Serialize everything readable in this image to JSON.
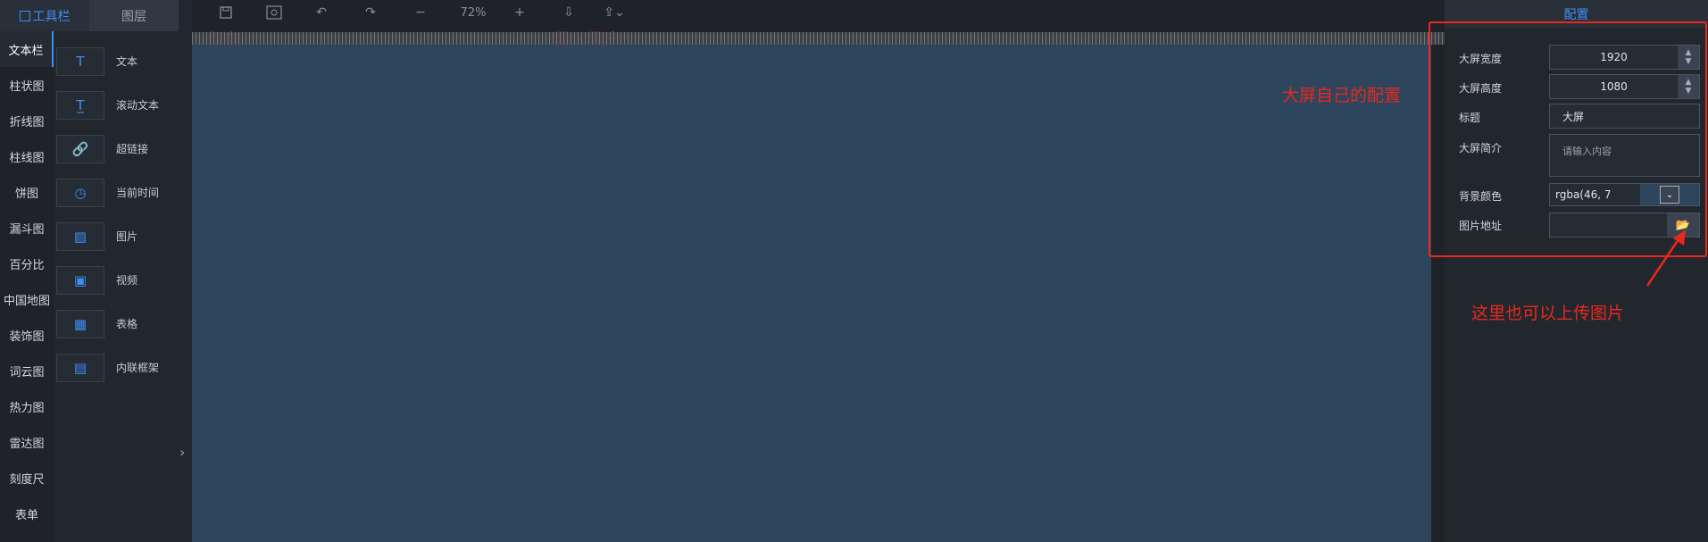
{
  "left_tabs": {
    "toolbox": "工具栏",
    "layers": "图层"
  },
  "categories": [
    "文本栏",
    "柱状图",
    "折线图",
    "柱线图",
    "饼图",
    "漏斗图",
    "百分比",
    "中国地图",
    "装饰图",
    "词云图",
    "热力图",
    "雷达图",
    "刻度尺",
    "表单"
  ],
  "items": [
    {
      "label": "文本",
      "icon": "T"
    },
    {
      "label": "滚动文本",
      "icon": "T̲"
    },
    {
      "label": "超链接",
      "icon": "🔗"
    },
    {
      "label": "当前时间",
      "icon": "◷"
    },
    {
      "label": "图片",
      "icon": "▨"
    },
    {
      "label": "视频",
      "icon": "▣"
    },
    {
      "label": "表格",
      "icon": "▦"
    },
    {
      "label": "内联框架",
      "icon": "▤"
    }
  ],
  "toolbar": {
    "zoom": "72%"
  },
  "annotations": {
    "save": "保存",
    "import_export": "导入导出",
    "screen_config": "大屏自己的配置",
    "upload_hint": "这里也可以上传图片"
  },
  "config": {
    "title": "配置",
    "width_label": "大屏宽度",
    "width_value": "1920",
    "height_label": "大屏高度",
    "height_value": "1080",
    "name_label": "标题",
    "name_value": "大屏",
    "desc_label": "大屏简介",
    "desc_placeholder": "请输入内容",
    "bg_label": "背景颜色",
    "bg_value": "rgba(46, 7",
    "img_label": "图片地址"
  },
  "colors": {
    "accent": "#3e8ef7",
    "canvas": "#2e465d",
    "annotation": "#e8281e"
  }
}
